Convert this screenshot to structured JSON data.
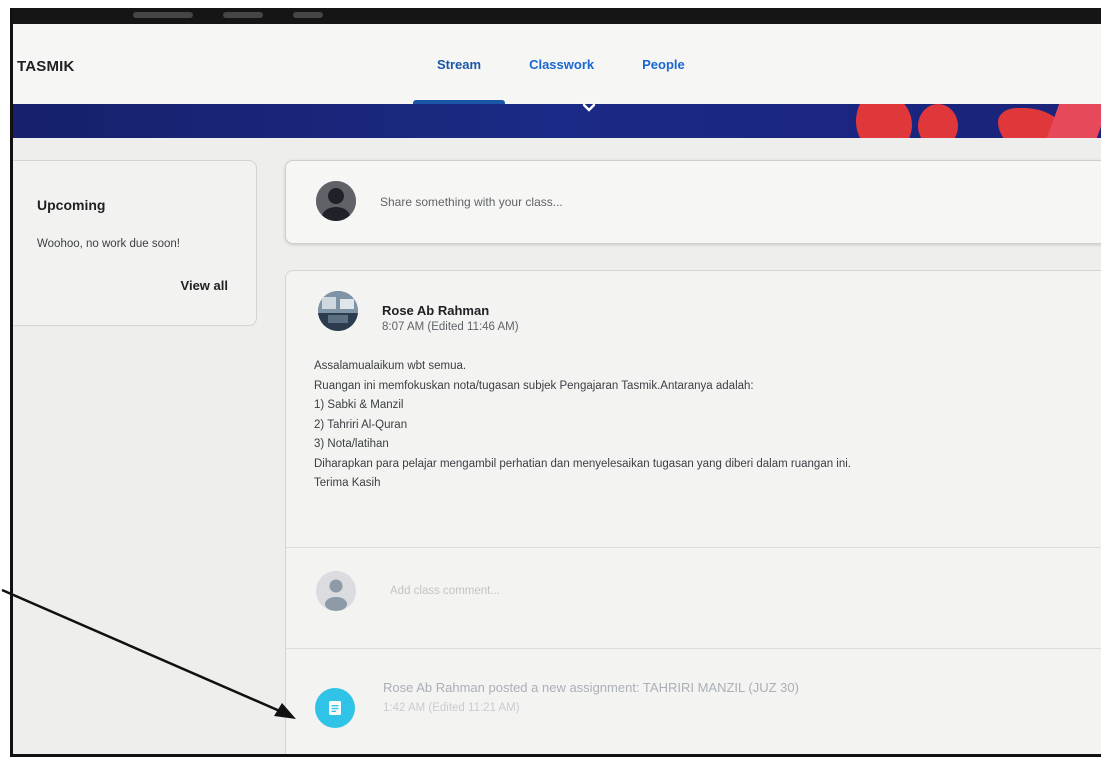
{
  "app": {
    "class_name": "TASMIK"
  },
  "tabs": [
    {
      "label": "Stream",
      "active": true
    },
    {
      "label": "Classwork",
      "active": false
    },
    {
      "label": "People",
      "active": false
    }
  ],
  "upcoming": {
    "title": "Upcoming",
    "message": "Woohoo, no work due soon!",
    "view_all": "View all"
  },
  "share": {
    "placeholder": "Share something with your class..."
  },
  "post": {
    "author": "Rose Ab Rahman",
    "time": "8:07 AM (Edited 11:46 AM)",
    "body_lines": [
      "Assalamualaikum wbt semua.",
      "Ruangan ini memfokuskan nota/tugasan subjek Pengajaran Tasmik.Antaranya adalah:",
      "1) Sabki & Manzil",
      "2) Tahriri Al-Quran",
      "3) Nota/latihan",
      "Diharapkan para pelajar mengambil perhatian dan menyelesaikan tugasan yang diberi dalam ruangan ini.",
      "Terima Kasih"
    ],
    "comment_placeholder": "Add class comment..."
  },
  "assignment": {
    "text": "Rose Ab Rahman posted a new assignment: TAHRIRI MANZIL (JUZ 30)",
    "time": "1:42 AM (Edited 11:21 AM)"
  },
  "colors": {
    "tab_text": "#1967d2",
    "banner": "#1b2a86",
    "banner_accent": "#e0373b",
    "assignment_icon": "#2fc4e7"
  },
  "icons": {
    "expand": "chevron-down-icon",
    "user_avatar": "avatar-icon",
    "assignment": "assignment-icon"
  }
}
